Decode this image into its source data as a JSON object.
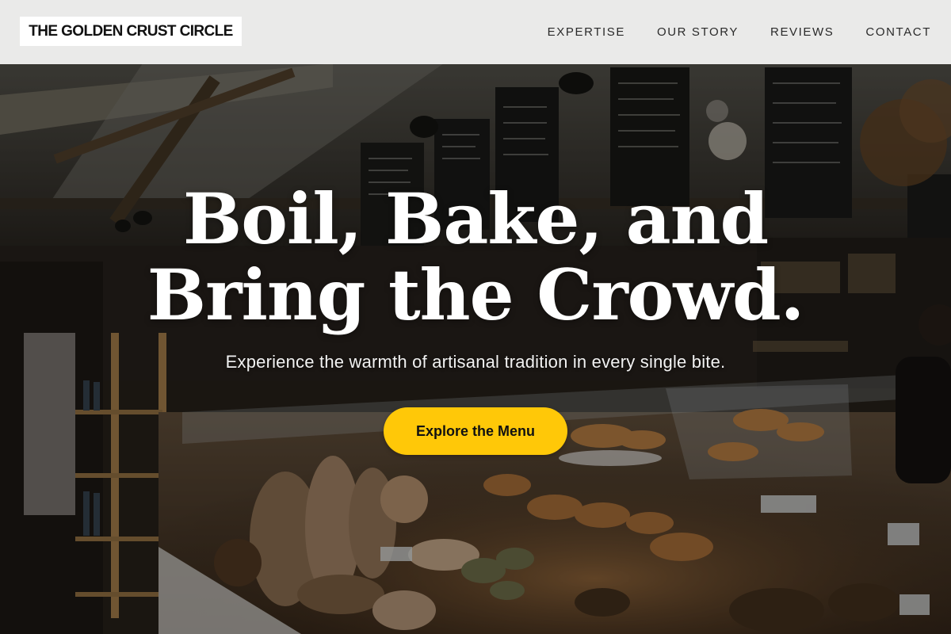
{
  "brand": {
    "name": "THE GOLDEN CRUST CIRCLE"
  },
  "nav": {
    "items": [
      {
        "label": "EXPERTISE"
      },
      {
        "label": "OUR STORY"
      },
      {
        "label": "REVIEWS"
      },
      {
        "label": "CONTACT"
      }
    ]
  },
  "hero": {
    "title_line1": "Boil, Bake, and",
    "title_line2": "Bring the Crowd.",
    "subtitle": "Experience the warmth of artisanal tradition in every single bite.",
    "cta_label": "Explore the Menu"
  },
  "colors": {
    "accent": "#ffc808",
    "header_bg": "#f6f6f6",
    "text_dark": "#111111",
    "hero_text": "#ffffff"
  }
}
